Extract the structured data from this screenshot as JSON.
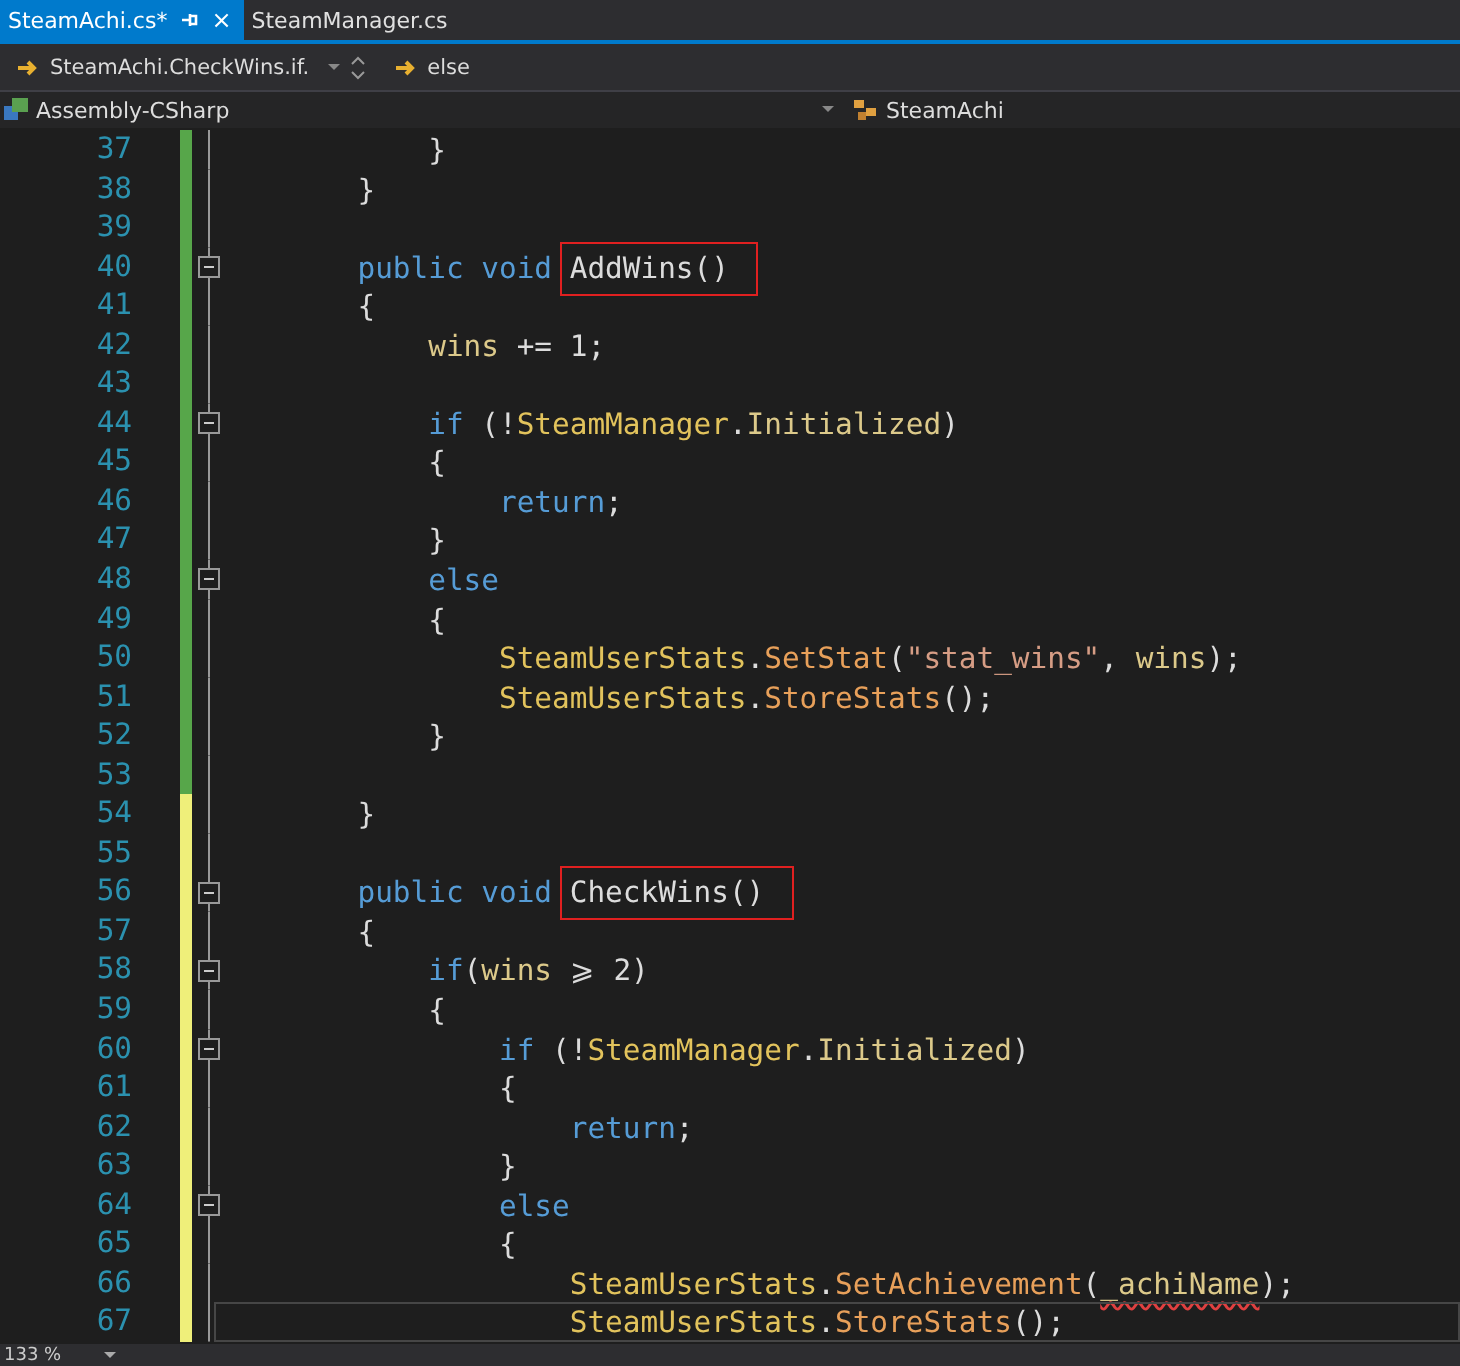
{
  "tabs": [
    {
      "label": "SteamAchi.cs*",
      "selected": true,
      "close": "×"
    },
    {
      "label": "SteamManager.cs",
      "selected": false
    }
  ],
  "nav_bar": {
    "member": "SteamAchi.CheckWins.if.",
    "scope": "else"
  },
  "context_bar": {
    "project": "Assembly-CSharp",
    "class": "SteamAchi"
  },
  "lines": [
    {
      "number": "37",
      "saved": true,
      "fold": false,
      "tokens": [
        {
          "t": "            }",
          "kind": "plain"
        }
      ]
    },
    {
      "number": "38",
      "saved": true,
      "fold": false,
      "tokens": [
        {
          "t": "        }",
          "kind": "plain"
        }
      ]
    },
    {
      "number": "39",
      "saved": true,
      "fold": false
    },
    {
      "number": "40",
      "saved": true,
      "fold": true,
      "tokens": [
        {
          "t": "        public void ",
          "kind": "keyword"
        },
        {
          "t": "AddWins()",
          "kind": "plain",
          "boxed": true
        }
      ]
    },
    {
      "number": "41",
      "saved": true,
      "fold": false,
      "tokens": [
        {
          "t": "        {",
          "kind": "plain"
        }
      ]
    },
    {
      "number": "42",
      "saved": true,
      "fold": false,
      "tokens": [
        {
          "t": "            wins",
          "kind": "field"
        },
        {
          "t": " += 1;",
          "kind": "plain"
        }
      ]
    },
    {
      "number": "43",
      "saved": true,
      "fold": false
    },
    {
      "number": "44",
      "saved": true,
      "fold": true,
      "tokens": [
        {
          "t": "            if",
          "kind": "keyword"
        },
        {
          "t": " (!",
          "kind": "plain"
        },
        {
          "t": "SteamManager",
          "kind": "class"
        },
        {
          "t": ".",
          "kind": "plain"
        },
        {
          "t": "Initialized",
          "kind": "field"
        },
        {
          "t": ")",
          "kind": "plain"
        }
      ]
    },
    {
      "number": "45",
      "saved": true,
      "fold": false,
      "tokens": [
        {
          "t": "            {",
          "kind": "plain"
        }
      ]
    },
    {
      "number": "46",
      "saved": true,
      "fold": false,
      "tokens": [
        {
          "t": "                return",
          "kind": "keyword"
        },
        {
          "t": ";",
          "kind": "plain"
        }
      ]
    },
    {
      "number": "47",
      "saved": true,
      "fold": false,
      "tokens": [
        {
          "t": "            }",
          "kind": "plain"
        }
      ]
    },
    {
      "number": "48",
      "saved": true,
      "fold": true,
      "tokens": [
        {
          "t": "            else",
          "kind": "keyword"
        }
      ]
    },
    {
      "number": "49",
      "saved": true,
      "fold": false,
      "tokens": [
        {
          "t": "            {",
          "kind": "plain"
        }
      ]
    },
    {
      "number": "50",
      "saved": true,
      "fold": false,
      "tokens": [
        {
          "t": "                SteamUserStats",
          "kind": "class"
        },
        {
          "t": ".",
          "kind": "plain"
        },
        {
          "t": "SetStat",
          "kind": "method"
        },
        {
          "t": "(",
          "kind": "plain"
        },
        {
          "t": "\"stat_wins\"",
          "kind": "string"
        },
        {
          "t": ", ",
          "kind": "plain"
        },
        {
          "t": "wins",
          "kind": "field"
        },
        {
          "t": ");",
          "kind": "plain"
        }
      ]
    },
    {
      "number": "51",
      "saved": true,
      "fold": false,
      "tokens": [
        {
          "t": "                SteamUserStats",
          "kind": "class"
        },
        {
          "t": ".",
          "kind": "plain"
        },
        {
          "t": "StoreStats",
          "kind": "method"
        },
        {
          "t": "();",
          "kind": "plain"
        }
      ]
    },
    {
      "number": "52",
      "saved": true,
      "fold": false,
      "tokens": [
        {
          "t": "            }",
          "kind": "plain"
        }
      ]
    },
    {
      "number": "53",
      "saved": true,
      "fold": false
    },
    {
      "number": "54",
      "saved": false,
      "fold": false,
      "tokens": [
        {
          "t": "        }",
          "kind": "plain"
        }
      ]
    },
    {
      "number": "55",
      "saved": false,
      "fold": false
    },
    {
      "number": "56",
      "saved": false,
      "fold": true,
      "tokens": [
        {
          "t": "        public void ",
          "kind": "keyword"
        },
        {
          "t": "CheckWins()",
          "kind": "plain",
          "boxed": true
        }
      ]
    },
    {
      "number": "57",
      "saved": false,
      "fold": false,
      "tokens": [
        {
          "t": "        {",
          "kind": "plain"
        }
      ]
    },
    {
      "number": "58",
      "saved": false,
      "fold": true,
      "tokens": [
        {
          "t": "            if",
          "kind": "keyword"
        },
        {
          "t": "(",
          "kind": "plain"
        },
        {
          "t": "wins",
          "kind": "field"
        },
        {
          "t": " ⩾ 2)",
          "kind": "plain"
        }
      ]
    },
    {
      "number": "59",
      "saved": false,
      "fold": false,
      "tokens": [
        {
          "t": "            {",
          "kind": "plain"
        }
      ]
    },
    {
      "number": "60",
      "saved": false,
      "fold": true,
      "tokens": [
        {
          "t": "                if",
          "kind": "keyword"
        },
        {
          "t": " (!",
          "kind": "plain"
        },
        {
          "t": "SteamManager",
          "kind": "class"
        },
        {
          "t": ".",
          "kind": "plain"
        },
        {
          "t": "Initialized",
          "kind": "field"
        },
        {
          "t": ")",
          "kind": "plain"
        }
      ]
    },
    {
      "number": "61",
      "saved": false,
      "fold": false,
      "tokens": [
        {
          "t": "                {",
          "kind": "plain"
        }
      ]
    },
    {
      "number": "62",
      "saved": false,
      "fold": false,
      "tokens": [
        {
          "t": "                    return",
          "kind": "keyword"
        },
        {
          "t": ";",
          "kind": "plain"
        }
      ]
    },
    {
      "number": "63",
      "saved": false,
      "fold": false,
      "tokens": [
        {
          "t": "                }",
          "kind": "plain"
        }
      ]
    },
    {
      "number": "64",
      "saved": false,
      "fold": true,
      "tokens": [
        {
          "t": "                else",
          "kind": "keyword"
        }
      ]
    },
    {
      "number": "65",
      "saved": false,
      "fold": false,
      "tokens": [
        {
          "t": "                {",
          "kind": "plain"
        }
      ]
    },
    {
      "number": "66",
      "saved": false,
      "fold": false,
      "tokens": [
        {
          "t": "                    SteamUserStats",
          "kind": "class"
        },
        {
          "t": ".",
          "kind": "plain"
        },
        {
          "t": "SetAchievement",
          "kind": "method"
        },
        {
          "t": "(",
          "kind": "plain"
        },
        {
          "t": "_achiName",
          "kind": "field",
          "error": true
        },
        {
          "t": ");",
          "kind": "plain"
        }
      ]
    },
    {
      "number": "67",
      "saved": false,
      "fold": false,
      "current": true,
      "tokens": [
        {
          "t": "                    SteamUserStats",
          "kind": "class"
        },
        {
          "t": ".",
          "kind": "plain"
        },
        {
          "t": "StoreStats",
          "kind": "method"
        },
        {
          "t": "();",
          "kind": "plain"
        }
      ]
    }
  ],
  "status_bar": {
    "zoom": "133 %"
  }
}
